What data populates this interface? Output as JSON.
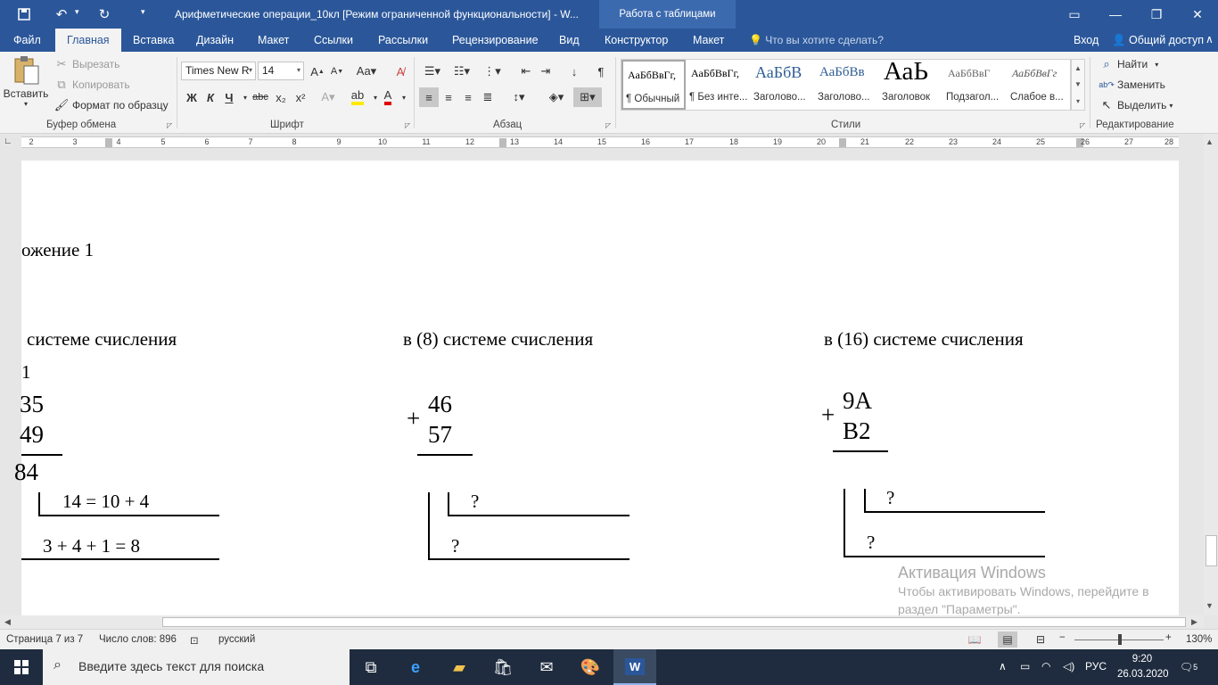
{
  "titlebar": {
    "doc_title": "Арифметические операции_10кл [Режим ограниченной функциональности] - W...",
    "context_header": "Работа с таблицами",
    "save_icon": "save-icon",
    "undo_icon": "undo-icon",
    "redo_icon": "redo-icon"
  },
  "tabs": [
    "Файл",
    "Главная",
    "Вставка",
    "Дизайн",
    "Макет",
    "Ссылки",
    "Рассылки",
    "Рецензирование",
    "Вид",
    "Конструктор",
    "Макет"
  ],
  "active_tab": "Главная",
  "tellme": "Что вы хотите сделать?",
  "signin": "Вход",
  "share": "Общий доступ",
  "clipboard": {
    "paste": "Вставить",
    "cut": "Вырезать",
    "copy": "Копировать",
    "format_painter": "Формат по образцу",
    "label": "Буфер обмена"
  },
  "font": {
    "name": "Times New R",
    "size": "14",
    "bold": "Ж",
    "italic": "К",
    "underline": "Ч",
    "strike": "abc",
    "sub": "x₂",
    "sup": "x²",
    "label": "Шрифт"
  },
  "paragraph": {
    "label": "Абзац"
  },
  "styles": {
    "items": [
      {
        "sample": "АаБбВвГг,",
        "name": "¶ Обычный"
      },
      {
        "sample": "АаБбВвГг,",
        "name": "¶ Без инте..."
      },
      {
        "sample": "АаБбВ",
        "name": "Заголово..."
      },
      {
        "sample": "АаБбВв",
        "name": "Заголово..."
      },
      {
        "sample": "АаЬ",
        "name": "Заголовок"
      },
      {
        "sample": "АаБбВвГ",
        "name": "Подзагол..."
      },
      {
        "sample": "АаБбВвГг",
        "name": "Слабое в..."
      }
    ],
    "label": "Стили"
  },
  "editing": {
    "find": "Найти",
    "replace": "Заменить",
    "select": "Выделить",
    "label": "Редактирование"
  },
  "ruler": {
    "numbers": [
      "2",
      "3",
      "4",
      "5",
      "6",
      "7",
      "8",
      "9",
      "10",
      "11",
      "12",
      "13",
      "14",
      "15",
      "16",
      "17",
      "18",
      "19",
      "20",
      "21",
      "22",
      "23",
      "24",
      "25",
      "26",
      "27",
      "28"
    ]
  },
  "document": {
    "heading": "ожение 1",
    "col1": {
      "title": "системе счисления",
      "carry": "1",
      "a": "35",
      "b": "49",
      "result": "84",
      "note1": "14 = 10 + 4",
      "note2": "3 + 4 + 1 = 8"
    },
    "col2": {
      "title": "в (8) системе счисления",
      "plus": "+",
      "a": "46",
      "b": "57",
      "q1": "?",
      "q2": "?"
    },
    "col3": {
      "title": "в (16) системе счисления",
      "plus": "+",
      "a": "9A",
      "b": "B2",
      "q1": "?",
      "q2": "?"
    }
  },
  "watermark": {
    "title": "Активация Windows",
    "text": "Чтобы активировать Windows, перейдите в раздел \"Параметры\"."
  },
  "status": {
    "page": "Страница 7 из 7",
    "words": "Число слов: 896",
    "lang": "русский",
    "zoom": "130%",
    "zoom_level": 130
  },
  "taskbar": {
    "search_placeholder": "Введите здесь текст для поиска",
    "lang": "РУС",
    "time": "9:20",
    "date": "26.03.2020",
    "notifications": "5"
  }
}
